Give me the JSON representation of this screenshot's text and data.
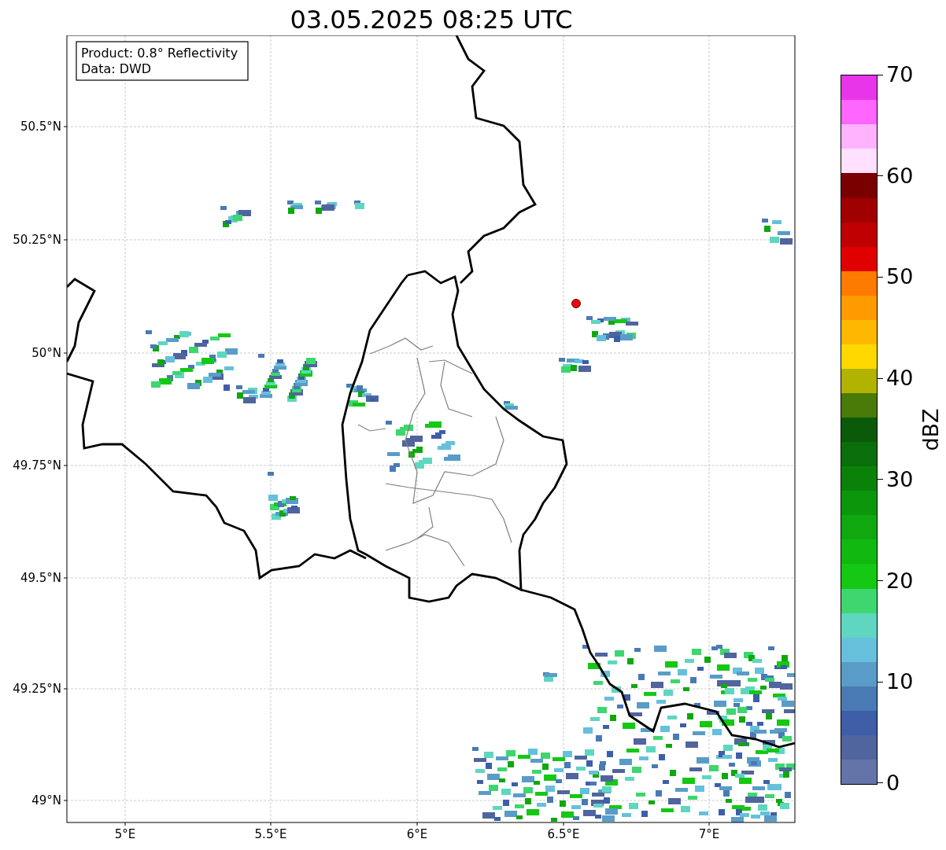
{
  "title": "03.05.2025 08:25 UTC",
  "map": {
    "legend": [
      "Product: 0.8° Reflectivity",
      "Data: DWD"
    ],
    "x_ticks": [
      "5°E",
      "5.5°E",
      "6°E",
      "6.5°E",
      "7°E"
    ],
    "y_ticks": [
      "50.5°N",
      "50.25°N",
      "50°N",
      "49.75°N",
      "49.5°N",
      "49.25°N",
      "49°N"
    ]
  },
  "colorbar": {
    "label": "dBZ",
    "ticks": [
      "70",
      "60",
      "50",
      "40",
      "30",
      "20",
      "10",
      "0"
    ],
    "segments": [
      {
        "color": "#6474a8"
      },
      {
        "color": "#50649e"
      },
      {
        "color": "#3e5ea8"
      },
      {
        "color": "#4a7ab4"
      },
      {
        "color": "#5a9cc8"
      },
      {
        "color": "#66c0dc"
      },
      {
        "color": "#5fd6c0"
      },
      {
        "color": "#3ed66e"
      },
      {
        "color": "#14c814"
      },
      {
        "color": "#10b810"
      },
      {
        "color": "#0fa80f"
      },
      {
        "color": "#0c960c"
      },
      {
        "color": "#0a820a"
      },
      {
        "color": "#0a6e0a"
      },
      {
        "color": "#0a5a0a"
      },
      {
        "color": "#4a7a08"
      },
      {
        "color": "#b2b200"
      },
      {
        "color": "#ffd800"
      },
      {
        "color": "#ffb800"
      },
      {
        "color": "#ff9a00"
      },
      {
        "color": "#ff7a00"
      },
      {
        "color": "#e00000"
      },
      {
        "color": "#c00000"
      },
      {
        "color": "#a00000"
      },
      {
        "color": "#7a0000"
      },
      {
        "color": "#ffe0ff"
      },
      {
        "color": "#ffb3ff"
      },
      {
        "color": "#ff66ff"
      },
      {
        "color": "#e935e9"
      }
    ]
  }
}
